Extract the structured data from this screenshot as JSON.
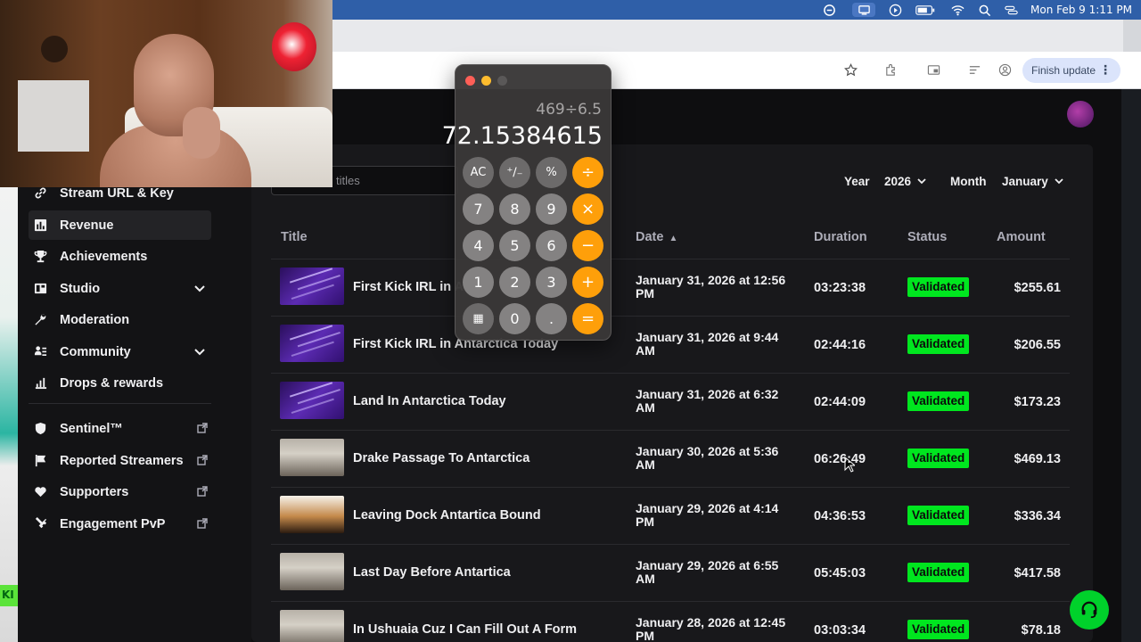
{
  "menubar": {
    "clock": "Mon Feb 9  1:11 PM"
  },
  "browser": {
    "finish_update": "Finish update",
    "menu_dots": "⋮"
  },
  "calculator": {
    "expression": "469÷6.5",
    "result": "72.15384615",
    "keys": [
      [
        "AC",
        "⁺∕₋",
        "%",
        "÷"
      ],
      [
        "7",
        "8",
        "9",
        "×"
      ],
      [
        "4",
        "5",
        "6",
        "−"
      ],
      [
        "1",
        "2",
        "3",
        "+"
      ],
      [
        "▦",
        "0",
        ".",
        "="
      ]
    ]
  },
  "sidebar": {
    "items": [
      {
        "label": "Stream URL & Key",
        "icon": "link-icon"
      },
      {
        "label": "Revenue",
        "icon": "chart-icon",
        "active": true
      },
      {
        "label": "Achievements",
        "icon": "trophy-icon"
      },
      {
        "label": "Studio",
        "icon": "studio-icon",
        "expandable": true
      },
      {
        "label": "Moderation",
        "icon": "wrench-icon"
      },
      {
        "label": "Community",
        "icon": "community-icon",
        "expandable": true
      },
      {
        "label": "Drops & rewards",
        "icon": "gift-icon"
      },
      {
        "label": "Sentinel™",
        "icon": "shield-icon",
        "external": true
      },
      {
        "label": "Reported Streamers",
        "icon": "flag-icon",
        "external": true
      },
      {
        "label": "Supporters",
        "icon": "heart-icon",
        "external": true
      },
      {
        "label": "Engagement PvP",
        "icon": "swords-icon",
        "external": true
      }
    ]
  },
  "filters": {
    "search_placeholder": "titles",
    "year_label": "Year",
    "year_value": "2026",
    "month_label": "Month",
    "month_value": "January"
  },
  "table": {
    "headers": {
      "title": "Title",
      "date": "Date",
      "duration": "Duration",
      "status": "Status",
      "amount": "Amount"
    },
    "rows": [
      {
        "title": "First Kick IRL in A",
        "date": "January 31, 2026 at 12:56 PM",
        "duration": "03:23:38",
        "status": "Validated",
        "amount": "$255.61",
        "thumb": "purple"
      },
      {
        "title": "First Kick IRL in Antarctica Today",
        "date": "January 31, 2026 at 9:44 AM",
        "duration": "02:44:16",
        "status": "Validated",
        "amount": "$206.55",
        "thumb": "purple"
      },
      {
        "title": "Land In Antarctica Today",
        "date": "January 31, 2026 at 6:32 AM",
        "duration": "02:44:09",
        "status": "Validated",
        "amount": "$173.23",
        "thumb": "purple"
      },
      {
        "title": "Drake Passage To Antarctica",
        "date": "January 30, 2026 at 5:36 AM",
        "duration": "06:26:49",
        "status": "Validated",
        "amount": "$469.13",
        "thumb": "photo"
      },
      {
        "title": "Leaving Dock Antartica Bound",
        "date": "January 29, 2026 at 4:14 PM",
        "duration": "04:36:53",
        "status": "Validated",
        "amount": "$336.34",
        "thumb": "dock"
      },
      {
        "title": "Last Day Before Antartica",
        "date": "January 29, 2026 at 6:55 AM",
        "duration": "05:45:03",
        "status": "Validated",
        "amount": "$417.58",
        "thumb": "photo"
      },
      {
        "title": "In Ushuaia Cuz I Can Fill Out A Form",
        "date": "January 28, 2026 at 12:45 PM",
        "duration": "03:03:34",
        "status": "Validated",
        "amount": "$78.18",
        "thumb": "photo"
      }
    ]
  },
  "colors": {
    "validated": "#00e61f",
    "calc_operator": "#fe9f0a",
    "menubar": "#2f5fa8"
  }
}
